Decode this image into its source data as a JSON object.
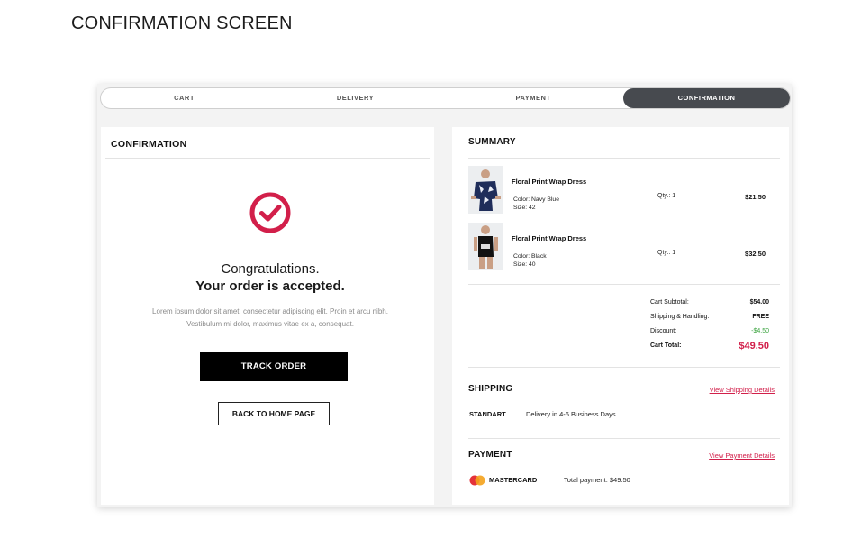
{
  "page": {
    "heading": "CONFIRMATION SCREEN"
  },
  "stepper": {
    "steps": [
      "CART",
      "DELIVERY",
      "PAYMENT",
      "CONFIRMATION"
    ],
    "active": "CONFIRMATION"
  },
  "confirmation": {
    "title": "CONFIRMATION",
    "headline_1": "Congratulations.",
    "headline_2": "Your order is accepted.",
    "body": "Lorem ipsum dolor sit amet, consectetur adipiscing elit. Proin et arcu nibh. Vestibulum mi dolor, maximus vitae ex a, consequat.",
    "track_button": "TRACK ORDER",
    "home_button": "BACK TO HOME PAGE",
    "check_color": "#d21f4a"
  },
  "summary": {
    "title": "SUMMARY",
    "items": [
      {
        "name": "Floral Print Wrap Dress",
        "color": "Color: Navy Blue",
        "size": "Size:   42",
        "qty": "Qty.:  1",
        "price": "$21.50"
      },
      {
        "name": "Floral Print Wrap Dress",
        "color": "Color: Black",
        "size": "Size:   40",
        "qty": "Qty.:  1",
        "price": "$32.50"
      }
    ],
    "totals": {
      "subtotal_label": "Cart Subtotal:",
      "subtotal_value": "$54.00",
      "shipping_label": "Shipping & Handling:",
      "shipping_value": "FREE",
      "discount_label": "Discount:",
      "discount_value": "-$4.50",
      "total_label": "Cart Total:",
      "total_value": "$49.50"
    }
  },
  "shipping": {
    "title": "SHIPPING",
    "link": "View Shipping Details",
    "method": "STANDART",
    "description": "Delivery in 4-6 Business Days"
  },
  "payment": {
    "title": "PAYMENT",
    "link": "View Payment Details",
    "card": "MASTERCARD",
    "total": "Total payment: $49.50"
  },
  "colors": {
    "accent": "#d21f4a",
    "discount": "#37a23c",
    "active_step": "#474a4f"
  }
}
